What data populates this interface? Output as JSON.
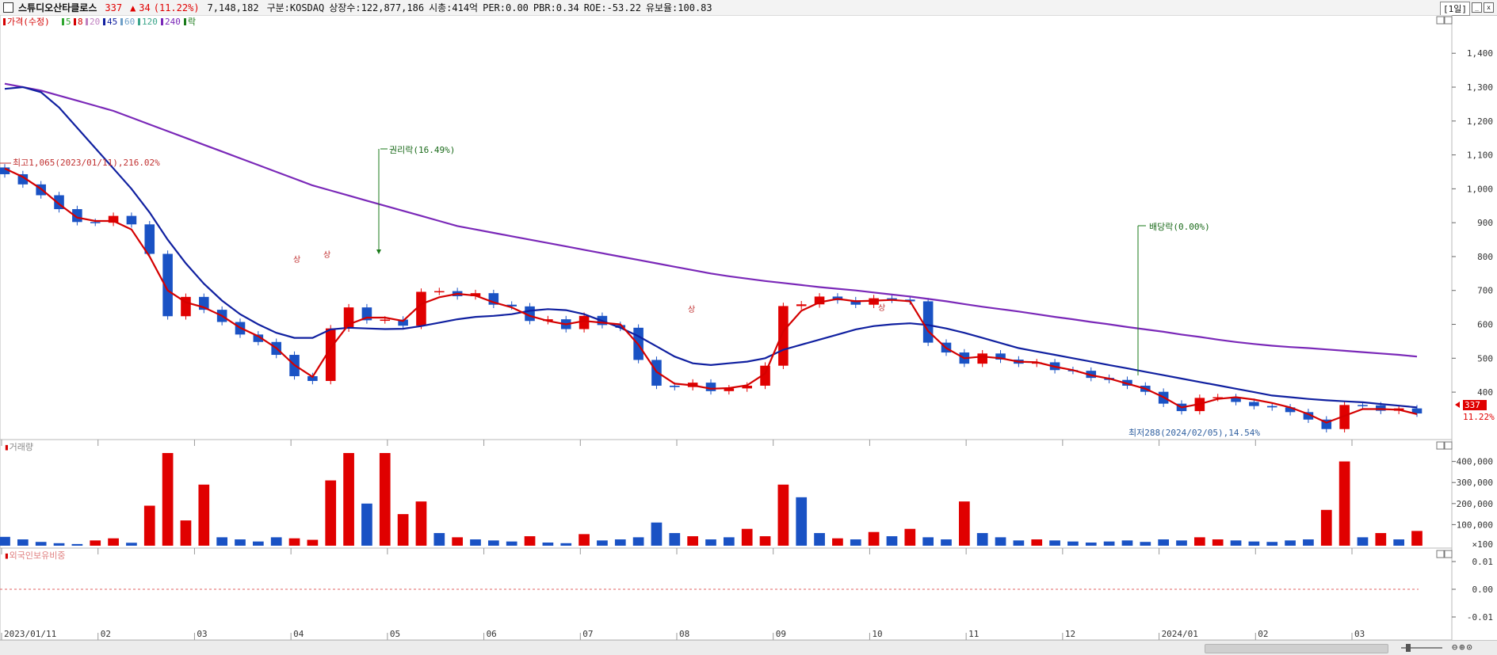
{
  "header": {
    "stock_name": "스튜디오산타클로스",
    "price": "337",
    "change_arrow": "▲",
    "change": "34",
    "change_pct": "(11.22%)",
    "volume": "7,148,182",
    "market": "구분:KOSDAQ",
    "shares": "상장수:122,877,186",
    "market_cap": "시총:414억",
    "per": "PER:0.00",
    "pbr": "PBR:0.34",
    "roe": "ROE:-53.22",
    "float": "유보율:100.83",
    "period": "[1일]"
  },
  "price_legend": [
    {
      "label": "가격(수정)",
      "color": "#d40000"
    },
    {
      "label": "5",
      "color": "#2fa62f"
    },
    {
      "label": "8",
      "color": "#d40000"
    },
    {
      "label": "20",
      "color": "#c080c0"
    },
    {
      "label": "45",
      "color": "#1020a0"
    },
    {
      "label": "60",
      "color": "#6fa0c8"
    },
    {
      "label": "120",
      "color": "#3aa58a"
    },
    {
      "label": "240",
      "color": "#7a28b8"
    },
    {
      "label": "락",
      "color": "#1a7a1a"
    }
  ],
  "volume_legend": "거래량",
  "foreign_legend": "외국인보유비중",
  "annotations": {
    "high": "최고1,065(2023/01/11),216.02%",
    "low": "최저288(2024/02/05),14.54%",
    "rights": "권리락(16.49%)",
    "dividend": "배당락(0.00%)",
    "sang": "상",
    "last_price": "337",
    "last_pct": "11.22%"
  },
  "colors": {
    "up": "#e00000",
    "down": "#1a52c4",
    "ma5": "#2fa62f",
    "ma8": "#d40000",
    "ma20": "#c080c0",
    "ma45": "#1020a0",
    "ma60": "#6fa0c8",
    "ma120": "#3aa58a",
    "ma240": "#7a28b8",
    "event": "#1a7a1a"
  },
  "chart_data": [
    {
      "type": "candlestick",
      "title": "스튜디오산타클로스",
      "y_ticks": [
        400,
        500,
        600,
        700,
        800,
        900,
        1000,
        1100,
        1200,
        1300,
        1400
      ],
      "ylim": [
        260,
        1480
      ],
      "x_ticks": [
        "2023/01/11",
        "02",
        "03",
        "04",
        "05",
        "06",
        "07",
        "08",
        "09",
        "10",
        "11",
        "12",
        "2024/01",
        "02",
        "03"
      ],
      "closes": [
        1043,
        1013,
        981,
        940,
        902,
        900,
        920,
        895,
        808,
        624,
        681,
        643,
        607,
        570,
        548,
        510,
        447,
        433,
        588,
        650,
        612,
        614,
        596,
        696,
        698,
        683,
        692,
        658,
        653,
        610,
        615,
        586,
        625,
        598,
        590,
        495,
        419,
        415,
        428,
        403,
        411,
        419,
        478,
        654,
        659,
        682,
        671,
        658,
        677,
        673,
        668,
        546,
        517,
        484,
        514,
        496,
        484,
        488,
        465,
        463,
        442,
        436,
        419,
        401,
        366,
        344,
        383,
        385,
        371,
        359,
        355,
        341,
        319,
        291,
        362,
        361,
        345,
        352,
        337
      ],
      "ma_series": {
        "ma8": [
          1060,
          1035,
          1000,
          955,
          915,
          905,
          905,
          880,
          800,
          700,
          665,
          650,
          625,
          590,
          565,
          530,
          480,
          445,
          530,
          600,
          620,
          620,
          610,
          660,
          680,
          690,
          685,
          665,
          650,
          625,
          610,
          600,
          610,
          605,
          600,
          540,
          460,
          425,
          420,
          410,
          412,
          420,
          455,
          580,
          640,
          665,
          675,
          668,
          670,
          672,
          668,
          580,
          530,
          500,
          505,
          500,
          490,
          488,
          475,
          465,
          450,
          440,
          425,
          410,
          385,
          355,
          365,
          380,
          385,
          378,
          368,
          355,
          335,
          310,
          330,
          350,
          350,
          348,
          335
        ],
        "ma45": [
          1295,
          1300,
          1285,
          1240,
          1180,
          1120,
          1060,
          1000,
          930,
          850,
          780,
          720,
          670,
          630,
          600,
          575,
          560,
          560,
          585,
          590,
          588,
          586,
          587,
          595,
          605,
          615,
          622,
          625,
          630,
          640,
          645,
          642,
          630,
          610,
          590,
          565,
          535,
          505,
          485,
          480,
          485,
          490,
          500,
          525,
          540,
          555,
          570,
          585,
          595,
          600,
          603,
          598,
          588,
          575,
          560,
          545,
          530,
          520,
          510,
          500,
          490,
          480,
          470,
          460,
          450,
          440,
          430,
          420,
          410,
          400,
          390,
          385,
          380,
          376,
          373,
          370,
          365,
          360,
          355
        ],
        "ma240": [
          1310,
          1300,
          1290,
          1275,
          1260,
          1245,
          1230,
          1210,
          1190,
          1170,
          1150,
          1130,
          1110,
          1090,
          1070,
          1050,
          1030,
          1010,
          995,
          980,
          965,
          950,
          935,
          920,
          905,
          890,
          880,
          870,
          860,
          850,
          840,
          830,
          820,
          810,
          800,
          790,
          780,
          770,
          760,
          750,
          742,
          735,
          728,
          722,
          716,
          710,
          705,
          700,
          694,
          688,
          682,
          675,
          668,
          660,
          652,
          645,
          638,
          630,
          622,
          615,
          607,
          600,
          592,
          585,
          578,
          570,
          563,
          555,
          548,
          542,
          537,
          533,
          530,
          526,
          522,
          518,
          514,
          510,
          505
        ]
      }
    },
    {
      "type": "bar",
      "title": "거래량",
      "y_ticks": [
        100000,
        200000,
        300000,
        400000
      ],
      "ylim": [
        0,
        470000
      ],
      "values": [
        42000,
        30000,
        18000,
        12000,
        8000,
        25000,
        35000,
        14000,
        190000,
        440000,
        120000,
        290000,
        40000,
        30000,
        20000,
        40000,
        35000,
        28000,
        310000,
        440000,
        200000,
        440000,
        150000,
        210000,
        60000,
        40000,
        30000,
        25000,
        20000,
        45000,
        15000,
        12000,
        55000,
        25000,
        30000,
        40000,
        110000,
        60000,
        45000,
        30000,
        40000,
        80000,
        45000,
        290000,
        230000,
        60000,
        35000,
        30000,
        65000,
        45000,
        80000,
        40000,
        30000,
        210000,
        60000,
        40000,
        25000,
        30000,
        25000,
        20000,
        15000,
        20000,
        25000,
        18000,
        30000,
        25000,
        40000,
        30000,
        25000,
        20000,
        18000,
        25000,
        30000,
        170000,
        400000,
        40000,
        60000,
        30000,
        70000
      ],
      "up": [
        0,
        0,
        0,
        0,
        0,
        1,
        1,
        0,
        1,
        1,
        1,
        1,
        0,
        0,
        0,
        0,
        1,
        1,
        1,
        1,
        0,
        1,
        1,
        1,
        0,
        1,
        0,
        0,
        0,
        1,
        0,
        0,
        1,
        0,
        0,
        0,
        0,
        0,
        1,
        0,
        0,
        1,
        1,
        1,
        0,
        0,
        1,
        0,
        1,
        0,
        1,
        0,
        0,
        1,
        0,
        0,
        0,
        1,
        0,
        0,
        0,
        0,
        0,
        0,
        0,
        0,
        1,
        1,
        0,
        0,
        0,
        0,
        0,
        1,
        1,
        0,
        1,
        0,
        1
      ]
    },
    {
      "type": "line",
      "title": "외국인보유비중",
      "y_ticks": [
        0.01,
        0.0,
        -0.01
      ],
      "values": [
        0,
        0
      ]
    }
  ]
}
